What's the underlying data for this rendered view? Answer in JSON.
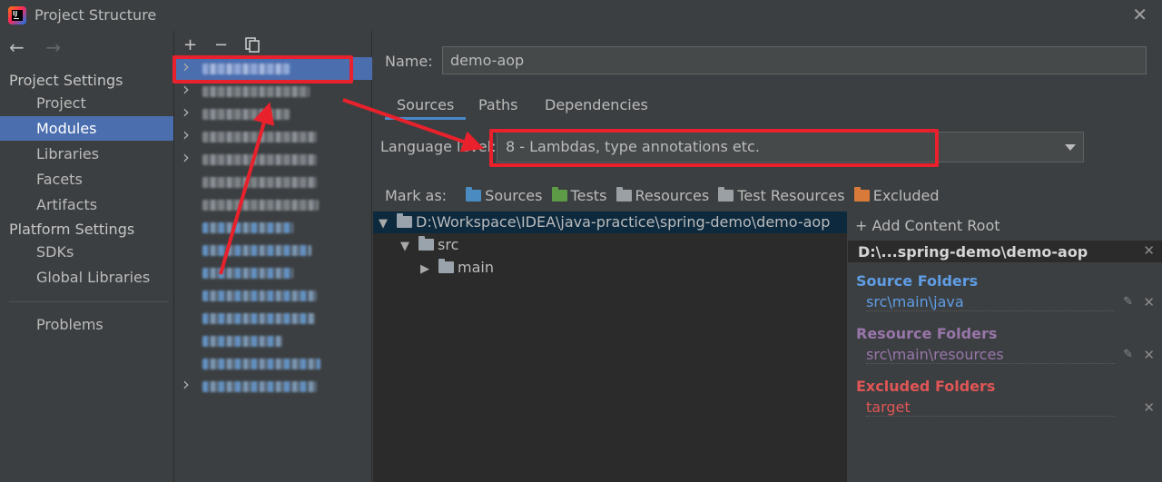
{
  "window": {
    "title": "Project Structure",
    "close_icon": "close-icon"
  },
  "nav": {
    "back_glyph": "←",
    "forward_glyph": "→",
    "project_settings_header": "Project Settings",
    "project_items": [
      "Project",
      "Modules",
      "Libraries",
      "Facets",
      "Artifacts"
    ],
    "selected": "Modules",
    "platform_settings_header": "Platform Settings",
    "platform_items": [
      "SDKs",
      "Global Libraries"
    ],
    "problems": "Problems"
  },
  "modules_toolbar": {
    "add": "+",
    "remove": "−",
    "copy_icon": "copy-icon"
  },
  "module_rows": 15,
  "main": {
    "name_label": "Name:",
    "name_value": "demo-aop",
    "tabs": [
      "Sources",
      "Paths",
      "Dependencies"
    ],
    "active_tab": "Sources",
    "language_level_label": "Language level:",
    "language_level_value": "8 - Lambdas, type annotations etc.",
    "mark_as": {
      "label": "Mark as:",
      "items": [
        "Sources",
        "Tests",
        "Resources",
        "Test Resources",
        "Excluded"
      ]
    }
  },
  "tree": {
    "root": "D:\\Workspace\\IDEA\\java-practice\\spring-demo\\demo-aop",
    "src": "src",
    "main": "main"
  },
  "content_root": {
    "add_label": "+ Add Content Root",
    "root_title": "D:\\...spring-demo\\demo-aop",
    "source_folders_title": "Source Folders",
    "source_folder_path": "src\\main\\java",
    "resource_folders_title": "Resource Folders",
    "resource_folder_path": "src\\main\\resources",
    "excluded_folders_title": "Excluded Folders",
    "excluded_folder_path": "target"
  },
  "colors": {
    "accent_selection": "#4b6eaf",
    "source_blue": "#5f9de4",
    "resource_purple": "#9876aa",
    "excluded_red": "#e05555",
    "annotation_red": "#e8212c"
  }
}
